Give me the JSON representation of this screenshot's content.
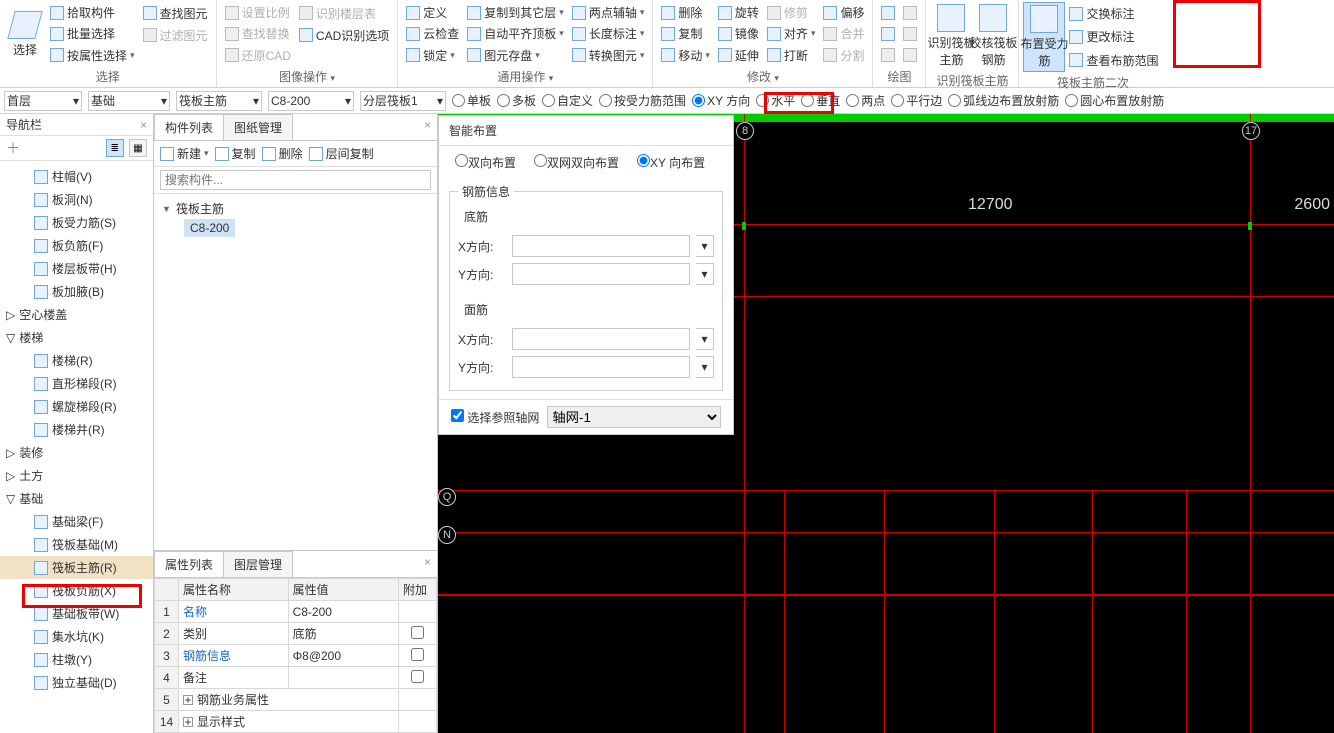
{
  "ribbon": {
    "select": {
      "label": "选择",
      "pick": "拾取构件",
      "batch": "批量选择",
      "byProp": "按属性选择",
      "findDraw": "查找图元",
      "filter": "过滤图元",
      "group": "选择"
    },
    "imageOp": {
      "group": "图像操作 ",
      "setRatio": "设置比例",
      "findReplace": "查找替换",
      "restoreCAD": "还原CAD",
      "identFloor": "识别楼层表",
      "cadOpt": "CAD识别选项"
    },
    "common": {
      "group": "通用操作 ",
      "define": "定义",
      "cloud": "云检查",
      "lock": "锁定",
      "copyOther": "复制到其它层",
      "autoAlignTop": "自动平齐顶板",
      "drawSave": "图元存盘",
      "twoPtAux": "两点辅轴",
      "lenMark": "长度标注",
      "convert": "转换图元"
    },
    "modify": {
      "group": "修改 ",
      "delete": "删除",
      "copy": "复制",
      "move": "移动",
      "rotate": "旋转",
      "mirror": "镜像",
      "extend": "延伸",
      "trim": "修剪",
      "align": "对齐",
      "break": "打断",
      "offset": "偏移",
      "merge": "合并",
      "split": "分割"
    },
    "draw": {
      "group": "绘图"
    },
    "identMain": {
      "group": "识别筏板主筋",
      "ident": "识别筏板主筋",
      "check": "校核筏板钢筋",
      "place": "布置受力筋",
      "swap": "交换标注",
      "editMark": "更改标注",
      "viewRange": "查看布筋范围",
      "secondary": "筏板主筋二次"
    }
  },
  "optbar": {
    "floor": "首层",
    "cat": "基础",
    "type": "筏板主筋",
    "spec": "C8-200",
    "layer": "分层筏板1",
    "modes": [
      "单板",
      "多板",
      "自定义",
      "按受力筋范围",
      "XY 方向",
      "水平",
      "垂直",
      "两点",
      "平行边",
      "弧线边布置放射筋",
      "圆心布置放射筋"
    ],
    "sel": "XY 方向"
  },
  "nav": {
    "title": "导航栏",
    "groupsTop": [
      "柱帽(V)",
      "板洞(N)",
      "板受力筋(S)",
      "板负筋(F)",
      "楼层板带(H)",
      "板加腋(B)"
    ],
    "hollow": "空心楼盖",
    "stairGrp": "楼梯",
    "stair": [
      "楼梯(R)",
      "直形梯段(R)",
      "螺旋梯段(R)",
      "楼梯井(R)"
    ],
    "more": [
      "装修",
      "土方"
    ],
    "baseGrp": "基础",
    "base": [
      "基础梁(F)",
      "筏板基础(M)",
      "筏板主筋(R)",
      "筏板负筋(X)",
      "基础板带(W)",
      "集水坑(K)",
      "柱墩(Y)",
      "独立基础(D)"
    ]
  },
  "mid": {
    "compTab": "构件列表",
    "drawTab": "图纸管理",
    "new": "新建",
    "copy": "复制",
    "delete": "删除",
    "layerCopy": "层间复制",
    "searchPH": "搜索构件...",
    "root": "筏板主筋",
    "child": "C8-200",
    "propTab": "属性列表",
    "layerTab": "图层管理",
    "hdrName": "属性名称",
    "hdrVal": "属性值",
    "hdrExt": "附加",
    "rows": [
      {
        "n": "1",
        "k": "名称",
        "v": "C8-200",
        "link": true
      },
      {
        "n": "2",
        "k": "类别",
        "v": "底筋"
      },
      {
        "n": "3",
        "k": "钢筋信息",
        "v": "Φ8@200",
        "link": true
      },
      {
        "n": "4",
        "k": "备注",
        "v": ""
      },
      {
        "n": "5",
        "k": "钢筋业务属性",
        "v": "",
        "exp": true
      },
      {
        "n": "14",
        "k": "显示样式",
        "v": "",
        "exp": true
      }
    ]
  },
  "panel": {
    "title": "智能布置",
    "r1": "双向布置",
    "r2": "双网双向布置",
    "r3": "XY 向布置",
    "steelInfo": "钢筋信息",
    "bottom": "底筋",
    "top": "面筋",
    "xlab": "X方向:",
    "ylab": "Y方向:",
    "axisChk": "选择参照轴网",
    "axisSel": "轴网-1"
  },
  "canvas": {
    "dim1": "12700",
    "dim2": "2600",
    "b8": "8",
    "b17": "17",
    "bQ": "Q",
    "bN": "N"
  }
}
